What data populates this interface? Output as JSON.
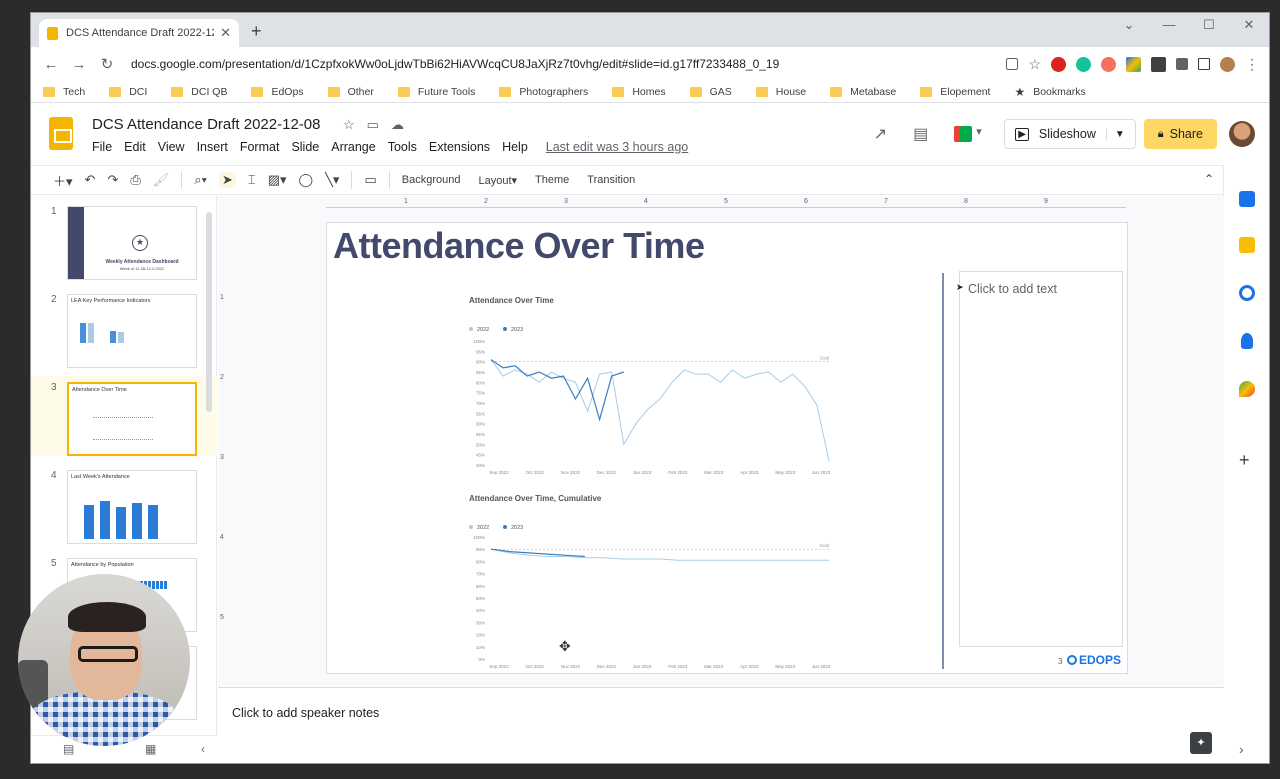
{
  "browser": {
    "tab_title": "DCS Attendance Draft 2022-12-0",
    "url": "docs.google.com/presentation/d/1CzpfxokWw0oLjdwTbBi62HiAVWcqCU8JaXjRz7t0vhg/edit#slide=id.g17ff7233488_0_19",
    "bookmarks": [
      "Tech",
      "DCI",
      "DCI QB",
      "EdOps",
      "Other",
      "Future Tools",
      "Photographers",
      "Homes",
      "GAS",
      "House",
      "Metabase",
      "Elopement",
      "Bookmarks"
    ]
  },
  "app": {
    "doc_title": "DCS Attendance Draft 2022-12-08",
    "menus": [
      "File",
      "Edit",
      "View",
      "Insert",
      "Format",
      "Slide",
      "Arrange",
      "Tools",
      "Extensions",
      "Help"
    ],
    "last_edit": "Last edit was 3 hours ago",
    "slideshow_label": "Slideshow",
    "share_label": "Share"
  },
  "toolbar": {
    "background": "Background",
    "layout": "Layout",
    "theme": "Theme",
    "transition": "Transition"
  },
  "filmstrip": [
    {
      "num": "1",
      "label": "Weekly Attendance Dashboard",
      "sub": "Week of 11.28-12.2.2022"
    },
    {
      "num": "2",
      "label": "LEA Key Performance Indicators"
    },
    {
      "num": "3",
      "label": "Attendance Over Time"
    },
    {
      "num": "4",
      "label": "Last Week's Attendance"
    },
    {
      "num": "5",
      "label": "Attendance by Population"
    }
  ],
  "ruler": {
    "marks": [
      "1",
      "2",
      "3",
      "4",
      "5",
      "6",
      "7",
      "8",
      "9"
    ],
    "vmarks": [
      "1",
      "2",
      "3",
      "4",
      "5"
    ]
  },
  "slide": {
    "title": "Attendance Over Time",
    "textbox_placeholder": "Click to add text",
    "number": "3",
    "logo_text": "EDOPS"
  },
  "notes_placeholder": "Click to add speaker notes",
  "chart_data": [
    {
      "type": "line",
      "title": "Attendance Over Time",
      "legend": [
        "2022",
        "2023"
      ],
      "y_ticks": [
        "100%",
        "95%",
        "90%",
        "85%",
        "80%",
        "75%",
        "70%",
        "65%",
        "60%",
        "55%",
        "50%",
        "45%",
        "40%"
      ],
      "x_ticks": [
        "Sep 2022",
        "Oct 2022",
        "Nov 2022",
        "Dec 2022",
        "Jan 2023",
        "Feb 2023",
        "Mar 2023",
        "Apr 2023",
        "May 2023",
        "Jun 2023"
      ],
      "goal_label": "Goal",
      "goal": 90,
      "ylim": [
        40,
        100
      ],
      "series": [
        {
          "name": "2022",
          "color": "#a9cbe6",
          "values": [
            91,
            83,
            86,
            84,
            80,
            85,
            82,
            80,
            66,
            84,
            85,
            50,
            60,
            67,
            72,
            80,
            86,
            84,
            84,
            80,
            86,
            82,
            84,
            85,
            80,
            84,
            78,
            69,
            42
          ]
        },
        {
          "name": "2023",
          "color": "#3a7ec2",
          "values": [
            91,
            87,
            88,
            83,
            85,
            82,
            83,
            72,
            82,
            62,
            83,
            85
          ]
        }
      ]
    },
    {
      "type": "line",
      "title": "Attendance Over Time, Cumulative",
      "legend": [
        "2022",
        "2023"
      ],
      "y_ticks": [
        "100%",
        "90%",
        "80%",
        "70%",
        "60%",
        "50%",
        "40%",
        "30%",
        "20%",
        "10%",
        "0%"
      ],
      "x_ticks": [
        "Sep 2022",
        "Oct 2022",
        "Nov 2022",
        "Dec 2022",
        "Jan 2023",
        "Feb 2023",
        "Mar 2023",
        "Apr 2023",
        "May 2023",
        "Jun 2023"
      ],
      "goal_label": "Goal",
      "goal": 90,
      "ylim": [
        0,
        100
      ],
      "series": [
        {
          "name": "2022",
          "color": "#a9cbe6",
          "values": [
            90,
            87,
            85,
            84,
            84,
            83,
            83,
            82,
            82,
            82,
            81,
            81,
            81,
            81,
            81,
            81,
            81,
            81,
            81
          ]
        },
        {
          "name": "2023",
          "color": "#3a7ec2",
          "values": [
            90,
            88,
            87,
            86,
            85,
            84
          ]
        }
      ]
    }
  ]
}
